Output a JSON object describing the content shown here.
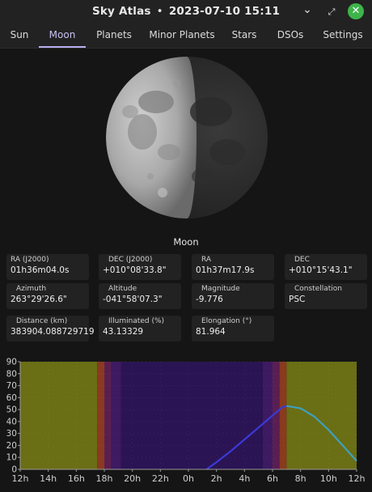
{
  "window": {
    "app_title": "Sky Atlas",
    "separator": "•",
    "datetime": "2023-07-10 15:11",
    "minimize_glyph": "⌄",
    "maximize_glyph": "⤢",
    "close_glyph": "✕",
    "close_color": "#3db44a"
  },
  "tabs": [
    {
      "label": "Sun",
      "active": false
    },
    {
      "label": "Moon",
      "active": true
    },
    {
      "label": "Planets",
      "active": false
    },
    {
      "label": "Minor Planets",
      "active": false
    },
    {
      "label": "Stars",
      "active": false
    },
    {
      "label": "DSOs",
      "active": false
    },
    {
      "label": "Settings",
      "active": false
    }
  ],
  "moon": {
    "name": "Moon",
    "illuminated_percent": 43.13329
  },
  "fields": {
    "ra_j2000": {
      "label": "RA (J2000)",
      "value": "01h36m04.0s"
    },
    "dec_j2000": {
      "label": "DEC (J2000)",
      "value": "+010°08'33.8\""
    },
    "ra": {
      "label": "RA",
      "value": "01h37m17.9s"
    },
    "dec": {
      "label": "DEC",
      "value": "+010°15'43.1\""
    },
    "azimuth": {
      "label": "Azimuth",
      "value": "263°29'26.6\""
    },
    "altitude": {
      "label": "Altitude",
      "value": "-041°58'07.3\""
    },
    "magnitude": {
      "label": "Magnitude",
      "value": "-9.776"
    },
    "constellation": {
      "label": "Constellation",
      "value": "PSC"
    },
    "distance": {
      "label": "Distance (km)",
      "value": "383904.088729719"
    },
    "illuminated": {
      "label": "Illuminated (%)",
      "value": "43.13329"
    },
    "elongation": {
      "label": "Elongation (°)",
      "value": "81.964"
    }
  },
  "chart_data": {
    "type": "line",
    "title": "",
    "xlabel": "",
    "ylabel": "",
    "x_ticks": [
      "12h",
      "14h",
      "16h",
      "18h",
      "20h",
      "22h",
      "0h",
      "2h",
      "4h",
      "6h",
      "8h",
      "10h",
      "12h"
    ],
    "y_ticks": [
      "0",
      "10",
      "20",
      "30",
      "40",
      "50",
      "60",
      "70",
      "80",
      "90"
    ],
    "xlim_hours": [
      0,
      24
    ],
    "ylim": [
      0,
      90
    ],
    "grid": true,
    "background_bands": [
      {
        "from": 0,
        "to": 5.5,
        "kind": "day",
        "color": "#6a6e14"
      },
      {
        "from": 5.5,
        "to": 6.0,
        "kind": "civil-twilight",
        "color": "#8a3a1e"
      },
      {
        "from": 6.0,
        "to": 6.5,
        "kind": "nautical-twilight",
        "color": "#5a1f50"
      },
      {
        "from": 6.5,
        "to": 7.2,
        "kind": "astronomical-twilight",
        "color": "#3d1a62"
      },
      {
        "from": 7.2,
        "to": 17.3,
        "kind": "night",
        "color": "#2a1454"
      },
      {
        "from": 17.3,
        "to": 18.0,
        "kind": "astronomical-twilight",
        "color": "#3d1a62"
      },
      {
        "from": 18.0,
        "to": 18.5,
        "kind": "nautical-twilight",
        "color": "#5a1f50"
      },
      {
        "from": 18.5,
        "to": 19.0,
        "kind": "civil-twilight",
        "color": "#8a3a1e"
      },
      {
        "from": 19.0,
        "to": 24,
        "kind": "day",
        "color": "#6a6e14"
      }
    ],
    "series": [
      {
        "x": [
          13.3,
          14.0,
          15.0,
          16.0,
          17.0,
          18.0,
          18.7,
          19.0,
          20.0,
          21.0,
          22.0,
          23.0,
          24.0
        ],
        "y": [
          0,
          6,
          15,
          25,
          35,
          45,
          52,
          53,
          51,
          44,
          33,
          20,
          7
        ],
        "color_below": "#3a3ad6",
        "color_above": "#3ea0c0"
      }
    ]
  }
}
